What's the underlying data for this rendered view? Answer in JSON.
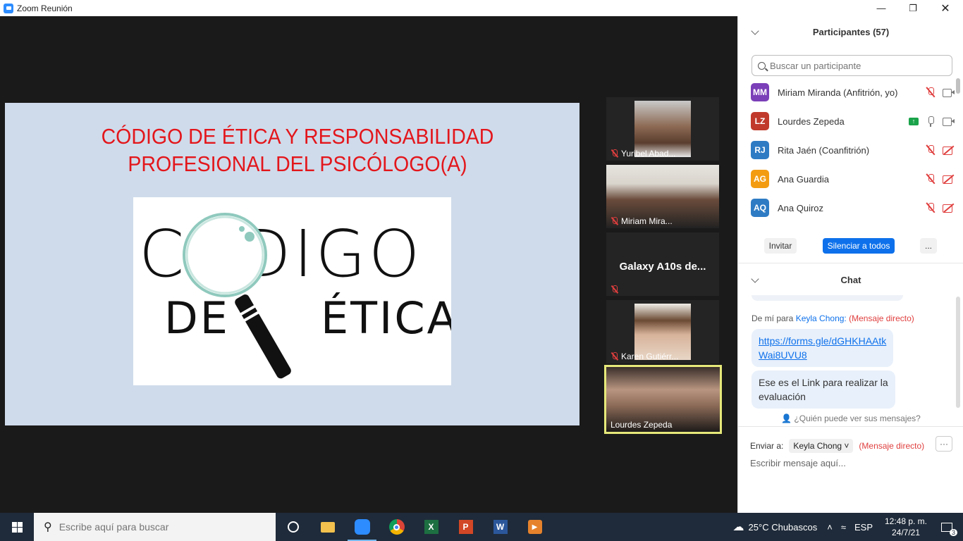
{
  "window": {
    "title": "Zoom Reunión"
  },
  "slide": {
    "title_line1": "CÓDIGO DE ÉTICA Y RESPONSABILIDAD",
    "title_line2": "PROFESIONAL DEL PSICÓLOGO(A)",
    "logo_word1": "CÓDIGO",
    "logo_word2": "DE   ÉTICA"
  },
  "video_tiles": [
    {
      "name": "Yuribel Abad...",
      "muted": true
    },
    {
      "name": "Miriam Mira...",
      "muted": true
    },
    {
      "name": "Galaxy A10s de...",
      "muted": true
    },
    {
      "name": "Karen Gutiérr...",
      "muted": true
    },
    {
      "name": "Lourdes Zepeda",
      "muted": false,
      "active_speaker": true
    }
  ],
  "participants": {
    "header": "Participantes (57)",
    "search_placeholder": "Buscar un participante",
    "list": [
      {
        "initials": "MM",
        "name": "Miriam Miranda (Anfitrión, yo)",
        "color": "#7b3fb8",
        "mic": "muted",
        "cam": "on"
      },
      {
        "initials": "LZ",
        "name": "Lourdes Zepeda",
        "color": "#c0392b",
        "mic": "on",
        "cam": "on",
        "sharing": true
      },
      {
        "initials": "RJ",
        "name": "Rita Jaén (Coanfitrión)",
        "color": "#2e7bc4",
        "mic": "muted",
        "cam": "off"
      },
      {
        "initials": "AG",
        "name": "Ana Guardia",
        "color": "#f39c12",
        "mic": "muted",
        "cam": "off"
      },
      {
        "initials": "AQ",
        "name": "Ana Quiroz",
        "color": "#2e7bc4",
        "mic": "muted",
        "cam": "off"
      }
    ],
    "invite_label": "Invitar",
    "mute_all_label": "Silenciar a todos",
    "more_label": "..."
  },
  "chat": {
    "header": "Chat",
    "meta_from": "De mí para",
    "meta_to": "Keyla Chong:",
    "meta_direct": "(Mensaje directo)",
    "link_text": "https://forms.gle/dGHKHAAtkWai8UVU8",
    "link_line1": "https://forms.gle/dGHKHAAtk",
    "link_line2": "Wai8UVU8",
    "message_line1": "Ese es el Link para realizar la",
    "message_line2": "evaluación",
    "who_can_see": "¿Quién puede ver sus mensajes?",
    "send_to_label": "Enviar a:",
    "recipient": "Keyla Chong",
    "direct_label": "(Mensaje directo)",
    "more_label": "···",
    "input_placeholder": "Escribir mensaje aquí..."
  },
  "taskbar": {
    "search_placeholder": "Escribe aquí para buscar",
    "weather": "25°C  Chubascos",
    "language": "ESP",
    "time": "12:48 p. m.",
    "date": "24/7/21",
    "notifications": "3"
  }
}
